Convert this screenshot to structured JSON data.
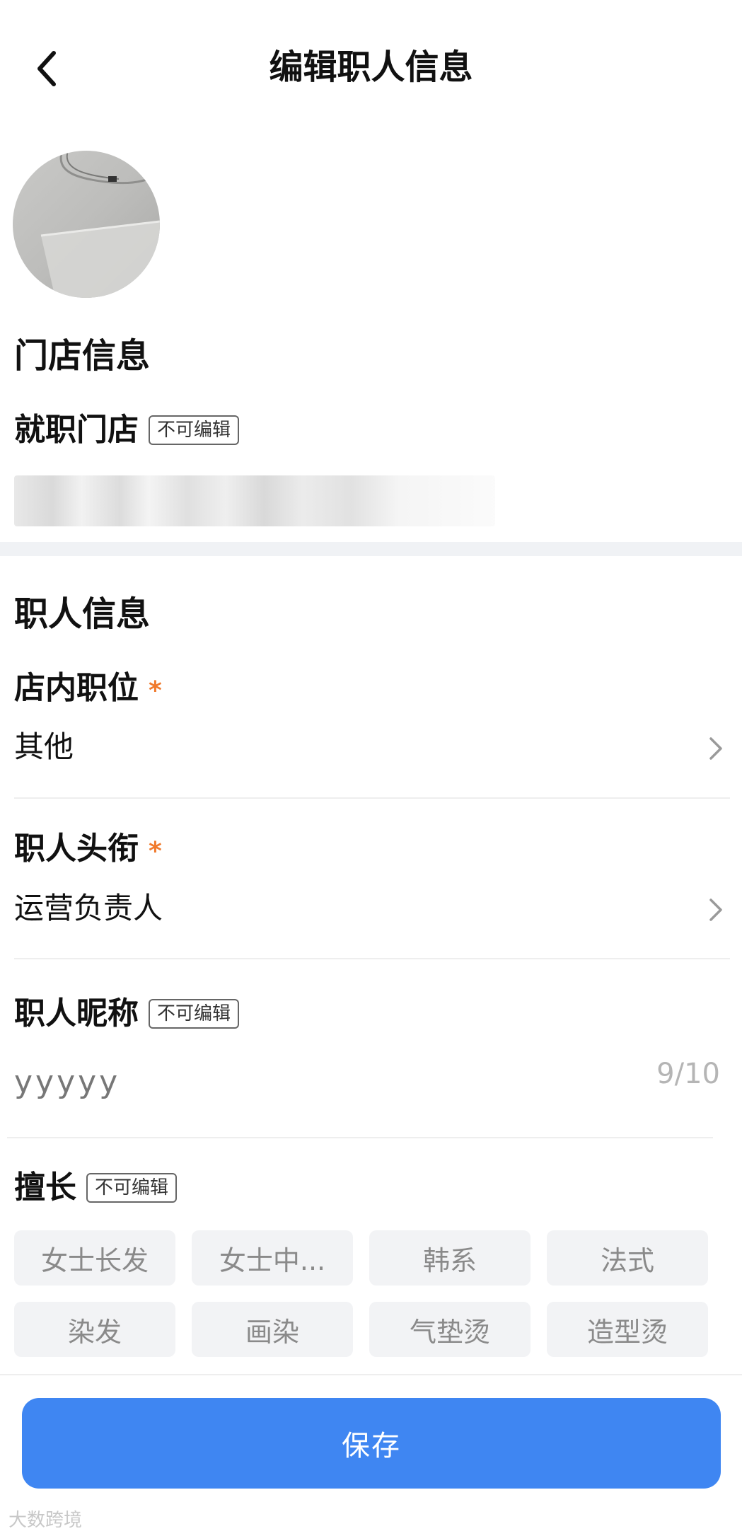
{
  "header": {
    "title": "编辑职人信息",
    "back_icon": "chevron-left-icon"
  },
  "avatar": {
    "alt": "avatar photo"
  },
  "store_section": {
    "title": "门店信息",
    "store_label": "就职门店",
    "store_tag": "不可编辑",
    "store_value": ""
  },
  "worker_section": {
    "title": "职人信息",
    "position": {
      "label": "店内职位",
      "required": "*",
      "value": "其他"
    },
    "job_title": {
      "label": "职人头衔",
      "required": "*",
      "value": "运营负责人"
    },
    "nickname": {
      "label": "职人昵称",
      "tag": "不可编辑",
      "value": "yyyyy",
      "counter": "9/10"
    },
    "skills": {
      "label": "擅长",
      "tag": "不可编辑",
      "items": [
        "女士长发",
        "女士中...",
        "韩系",
        "法式",
        "染发",
        "画染",
        "气垫烫",
        "造型烫"
      ]
    }
  },
  "footer": {
    "save_label": "保存"
  },
  "colors": {
    "primary": "#3f86f2",
    "required": "#f07a2d",
    "chip_bg": "#f2f3f5",
    "section_gap": "#f0f2f5"
  },
  "watermark": "大数跨境"
}
